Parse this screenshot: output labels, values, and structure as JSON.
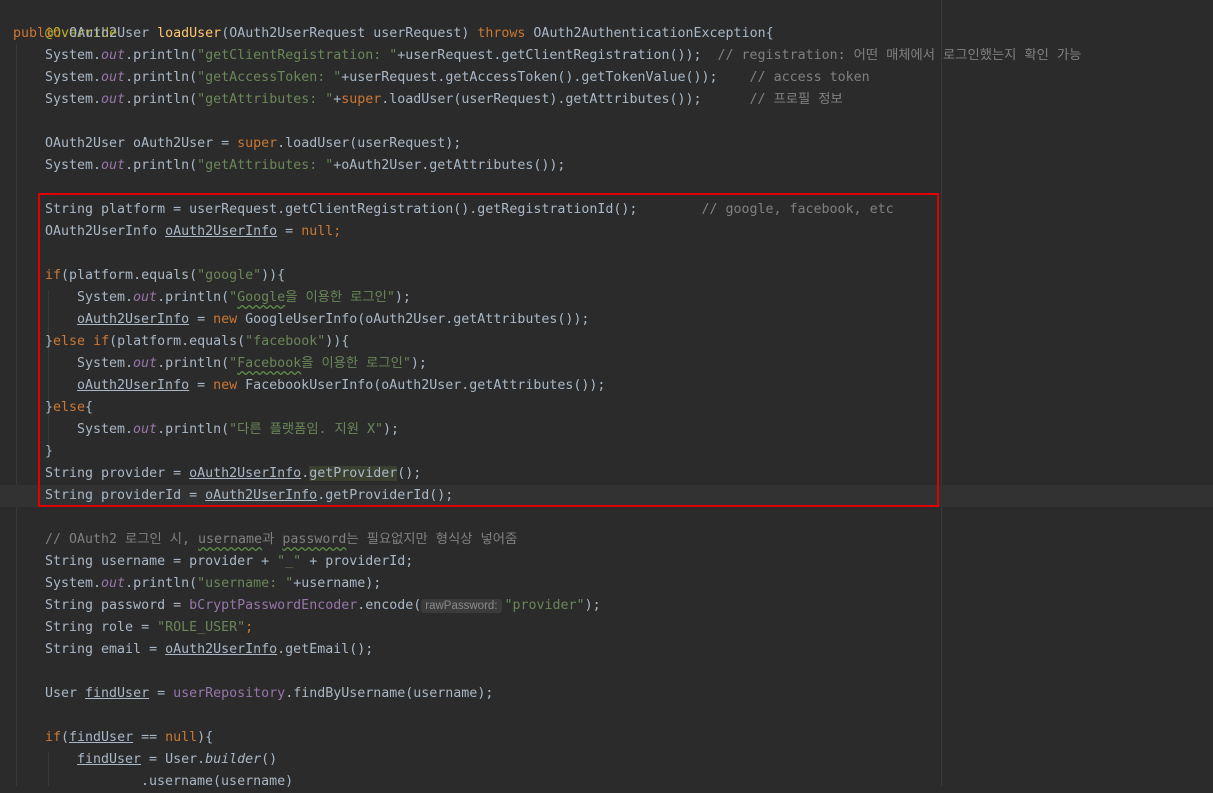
{
  "code": {
    "annotation": "@Override",
    "kw_public": "public",
    "ret_type": "OAuth2User",
    "method_name": "loadUser",
    "params": "(OAuth2UserRequest userRequest) ",
    "kw_throws": "throws",
    "exception": " OAuth2AuthenticationException{",
    "system": "System.",
    "out": "out",
    "println_open": ".println(",
    "str_client_reg": "\"getClientRegistration: \"",
    "expr_client_reg": "+userRequest.getClientRegistration());",
    "cmt_client_reg": "// registration: 어떤 매체에서 로그인했는지 확인 가능",
    "str_access_token": "\"getAccessToken: \"",
    "expr_access_token": "+userRequest.getAccessToken().getTokenValue());",
    "cmt_access_token": "// access token",
    "str_get_attr": "\"getAttributes: \"",
    "kw_super": "super",
    "expr_super_attr": ".loadUser(userRequest).getAttributes());",
    "cmt_profile": "// 프로필 정보",
    "decl_oauth2user": "OAuth2User oAuth2User = ",
    "expr_super_load": ".loadUser(userRequest);",
    "expr_oauth_attr": "+oAuth2User.getAttributes());",
    "decl_platform": "String platform = userRequest.getClientRegistration().getRegistrationId();",
    "cmt_platform": "// google, facebook, etc",
    "type_userinfo": "OAuth2UserInfo ",
    "var_userinfo": "oAuth2UserInfo",
    "assign": " = ",
    "kw_null": "null",
    "semicolon": ";",
    "kw_if": "if",
    "if_cond_open": "(platform.equals(",
    "str_google": "\"google\"",
    "if_cond_close": ")){",
    "str_google_login_q": "\"",
    "str_google_word": "Google",
    "str_google_rest": "을 이용한 로그인\"",
    "close_paren": ");",
    "kw_new": "new",
    "new_google": " GoogleUserInfo(oAuth2User.getAttributes());",
    "brace_close": "}",
    "kw_else": "else",
    "str_facebook": "\"facebook\"",
    "str_facebook_word": "Facebook",
    "str_facebook_rest": "을 이용한 로그인\"",
    "new_facebook": " FacebookUserInfo(oAuth2User.getAttributes());",
    "brace_open": "{",
    "str_other": "\"다른 플랫폼임. 지원 X\"",
    "decl_provider": "String provider = ",
    "method_get_provider": "getProvider",
    "call_end": "();",
    "decl_provider_id": "String providerId = ",
    "method_get_provider_id": ".getProviderId();",
    "cmt_oauth_login_a": "// OAuth2 로그인 시, ",
    "cmt_username": "username",
    "cmt_oauth_login_b": "과 ",
    "cmt_password": "password",
    "cmt_oauth_login_c": "는 필요없지만 형식상 넣어줌",
    "decl_username": "String username = provider + ",
    "str_underscore": "\"_\"",
    "expr_provider_id": " + providerId;",
    "str_username": "\"username: \"",
    "expr_username": "+username);",
    "decl_password": "String password = ",
    "field_bcrypt": "bCryptPasswordEncoder",
    "encode_open": ".encode(",
    "hint_raw_password": "rawPassword:",
    "str_provider": "\"provider\"",
    "decl_role": "String role = ",
    "str_role_user": "\"ROLE_USER\"",
    "decl_email": "String email = ",
    "expr_get_email": ".getEmail();",
    "type_user": "User ",
    "var_find_user": "findUser",
    "field_user_repo": "userRepository",
    "expr_find_by_username": ".findByUsername(username);",
    "if_open": "(",
    "eq_null": " == ",
    "if_close": "){",
    "user_dot": "User.",
    "builder": "builder",
    "builder_call": "()",
    "username_call": ".username(username)"
  },
  "colors": {
    "background": "#2b2b2b",
    "keyword": "#cc7832",
    "string": "#6a8759",
    "comment": "#808080",
    "method_decl": "#ffc66d",
    "annotation": "#bbb529",
    "static_field": "#9876aa",
    "highlight_box": "#e00000"
  }
}
